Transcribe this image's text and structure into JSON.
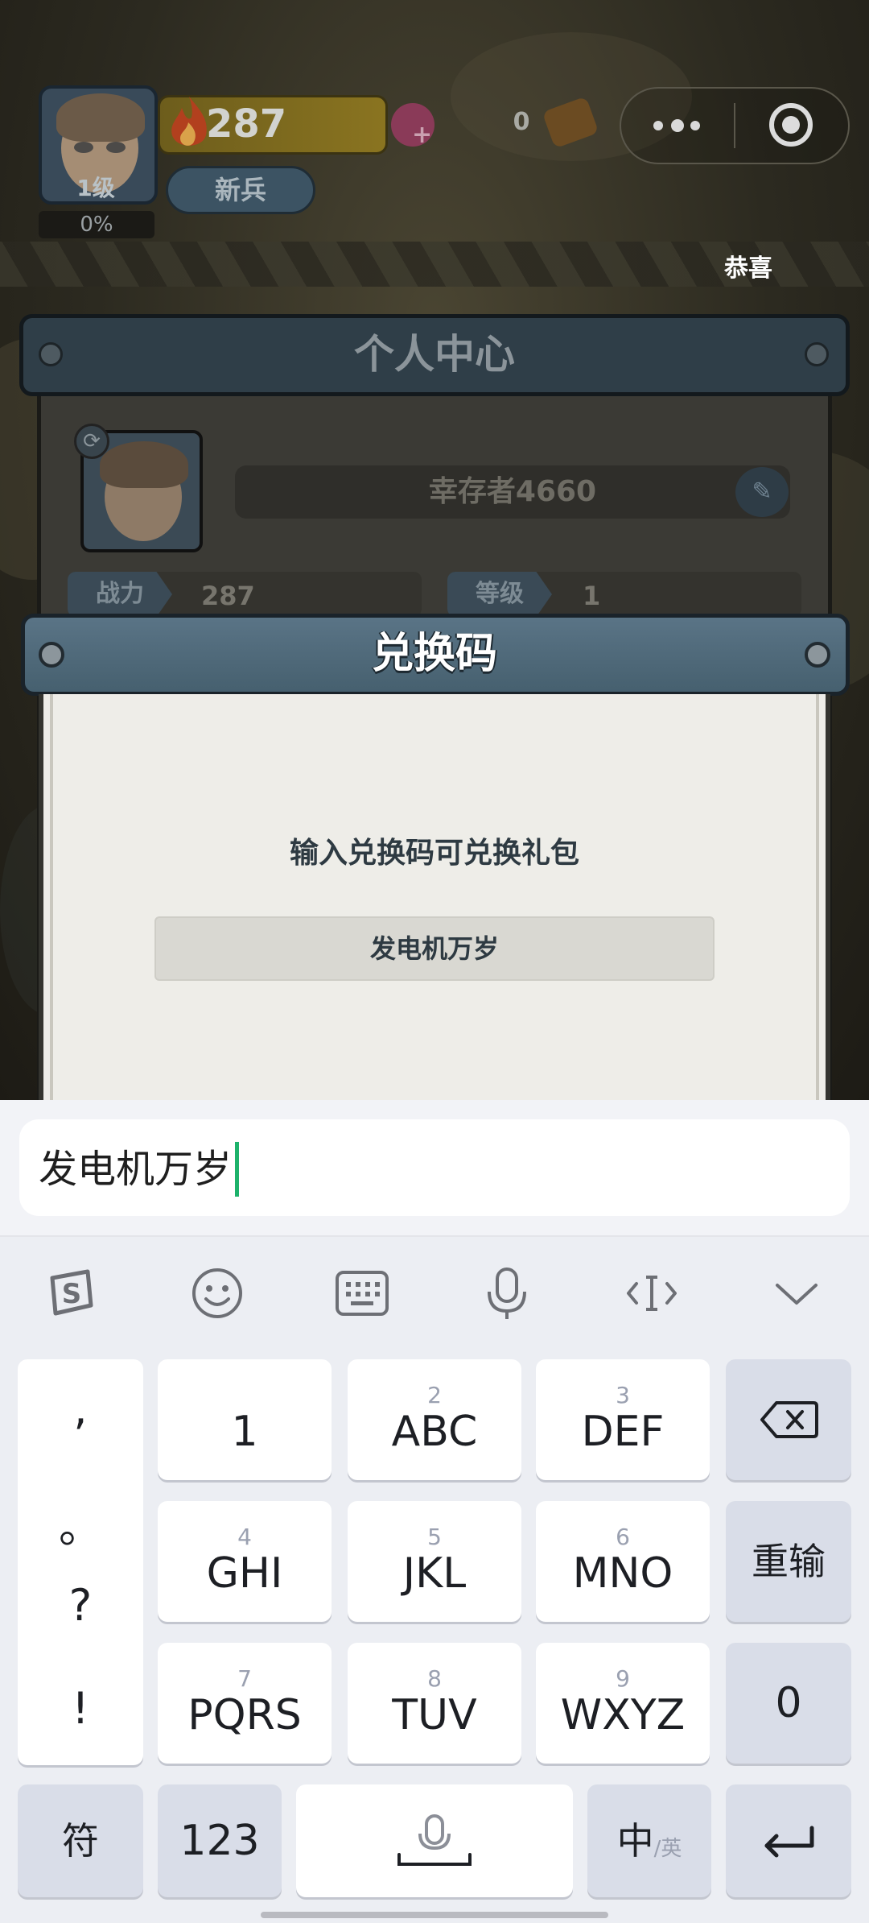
{
  "hud": {
    "level": "1级",
    "xp_percent": "0%",
    "power": "287",
    "rank": "新兵",
    "resource_count": "0",
    "congrats_text": "恭喜"
  },
  "personal_center": {
    "title": "个人中心",
    "player_name": "幸存者4660",
    "power_label": "战力",
    "power_value": "287",
    "level_label": "等级",
    "level_value": "1"
  },
  "redeem_dialog": {
    "title": "兑换码",
    "hint": "输入兑换码可兑换礼包",
    "code_value": "发电机万岁"
  },
  "ime": {
    "composition_text": "发电机万岁",
    "toolbar": [
      "sogou-logo-icon",
      "emoji-icon",
      "keyboard-icon",
      "microphone-icon",
      "cursor-move-icon",
      "collapse-chevron-icon"
    ],
    "punctuation": [
      ",",
      "。",
      "?",
      "!"
    ],
    "keys": {
      "k1": {
        "num": "",
        "label": "1"
      },
      "k2": {
        "num": "2",
        "label": "ABC"
      },
      "k3": {
        "num": "3",
        "label": "DEF"
      },
      "k4": {
        "num": "4",
        "label": "GHI"
      },
      "k5": {
        "num": "5",
        "label": "JKL"
      },
      "k6": {
        "num": "6",
        "label": "MNO"
      },
      "k7": {
        "num": "7",
        "label": "PQRS"
      },
      "k8": {
        "num": "8",
        "label": "TUV"
      },
      "k9": {
        "num": "9",
        "label": "WXYZ"
      }
    },
    "side_keys": {
      "reset": "重输",
      "zero": "0"
    },
    "bottom_row": {
      "symbols": "符",
      "numbers": "123",
      "lang_main": "中",
      "lang_sub": "/英"
    }
  }
}
